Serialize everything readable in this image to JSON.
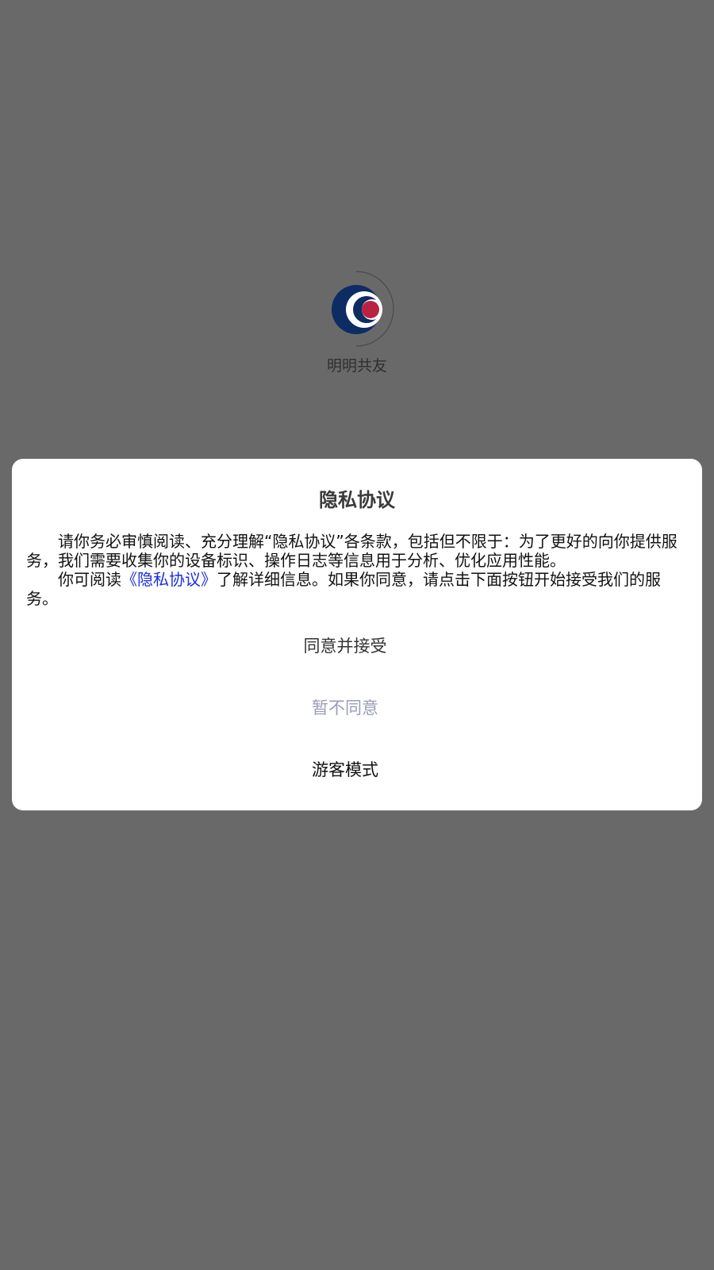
{
  "splash": {
    "app_name": "明明共友",
    "logo_icon": "app-logo-icon"
  },
  "colors": {
    "backdrop": "#696969",
    "dialog": "#ffffff",
    "link": "#1a2fe0",
    "decline_text": "#9a9cb8",
    "logo_navy": "#0c2c63",
    "logo_red": "#b82342"
  },
  "dialog": {
    "title": "隐私协议",
    "paragraph1": "请你务必审慎阅读、充分理解“隐私协议”各条款，包括但不限于：为了更好的向你提供服务，我们需要收集你的设备标识、操作日志等信息用于分析、优化应用性能。",
    "paragraph2_prefix": "你可阅读",
    "policy_link": "《隐私协议》",
    "paragraph2_suffix": "了解详细信息。如果你同意，请点击下面按钮开始接受我们的服务。",
    "buttons": {
      "agree": "同意并接受",
      "decline": "暂不同意",
      "guest": "游客模式"
    }
  }
}
